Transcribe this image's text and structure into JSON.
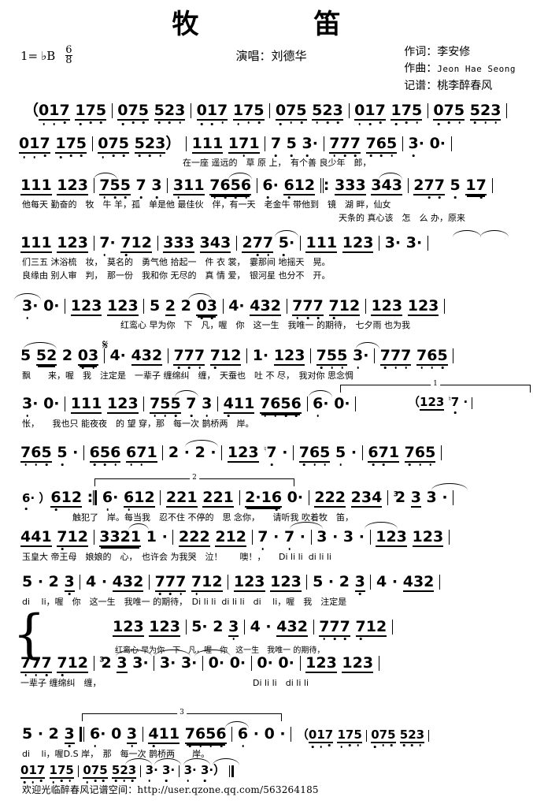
{
  "header": {
    "title": "牧　　笛",
    "key_label": "1=",
    "key_value": "♭B",
    "meter_num": "6",
    "meter_den": "8",
    "singer": "演唱：刘德华",
    "credits": [
      {
        "label": "作词：",
        "value": "李安修",
        "latin": false
      },
      {
        "label": "作曲：",
        "value": "Jeon Hae Seong",
        "latin": true
      },
      {
        "label": "记谱：",
        "value": "桃李醉春风",
        "latin": false
      }
    ]
  },
  "footer": {
    "text": "欢迎光临醉春风记谱空间：http://user.qzone.qq.com/563264185"
  },
  "chart_data": {
    "type": "table",
    "title": "牧笛 — 简谱 (Chinese numbered notation)",
    "key": "1=♭B",
    "time_signature": "6/8",
    "systems": [
      {
        "id": "intro-1",
        "notes": "（017 175 | 075 523 | 017 175 | 075 523 | 017 175 | 075 523 |",
        "lyrics": ""
      },
      {
        "id": "intro-2",
        "notes": "017 175 | 075 523）| 111 171 | 7 5 3· | 777 765 | 3· 0· |",
        "lyrics": "在一座 遥远的　草 原 上，　有个善 良少年　郎，"
      },
      {
        "id": "verse-1",
        "notes": "111 123 | 755 7 3 | 311 7656 | 6· 612 ‖: 333 343 | 277 5 17 |",
        "lyrics_1": "他每天 勤奋的　牧　牛 羊，孤　单是他 最佳伙　伴，有一天　老金牛 带他到　镜　湖 畔，仙女",
        "lyrics_2": "天条的 真心该　怎　么 办，原来"
      },
      {
        "id": "verse-2",
        "notes": "111 123 | 7· 712 | 333 343 | 277 5· | 111 123 | 3· 3· |",
        "lyrics_1": "们三五 沐浴梳　妆，　莫名的　勇气他 拾起一　件 衣 裳，　霎那间 地摇天　晃。",
        "lyrics_2": "良缘由 别人审　判，　那一份　我和你 无尽的　真 情 爱，　银河星 也分不　开。"
      },
      {
        "id": "chorus-1",
        "notes": "3· 0· | 123 123 | 5 2 2 03 | 4· 432 | 777 712 | 123 123 |",
        "lyrics": "　　　红鸾心 早为你　下　凡，喔　你　这一生　我唯一 的期待，　七夕雨 也为我"
      },
      {
        "id": "chorus-2",
        "notes": "5 52 2 03 | 4· 432 | 777 712 | 1· 123 | 755 3· | 777 765 |",
        "lyrics": "飘　　来，喔　我　注定是　一辈子 缠绵纠　缠，　天蚕也　吐 不 尽，　我对你 思念惆"
      },
      {
        "id": "chorus-3",
        "notes": "3· 0· | 111 123 | 755 7 3 | 411 7656 | 6· 0· | （123 ♮7· |",
        "lyrics": "怅，　　我也只 能夜夜　的 望 穿，那　每一次 鹊桥两　岸。",
        "volta": "1"
      },
      {
        "id": "inter-1",
        "notes": "765 5· | 656 671 | 2· 2· | 123 ♮7· | 765 5· | 671 765 |",
        "lyrics": ""
      },
      {
        "id": "inter-2",
        "notes": "6·）612 :‖ 6· 612 | 221 221 | 2·16 0· | 222 234 | ³2 3 3· |",
        "lyrics": "　　触犯了　岸。每当我　忍不住 不停的　思 念你，　　请听我 吹着牧　笛，",
        "volta": "2"
      },
      {
        "id": "bridge-1",
        "notes": "441 712 | 3321 1· | 222 212 | 7· 7· | 3· 3· | 123 123 |",
        "lyrics": "玉皇大 帝王母　娘娘的　心，　也许会 为我哭　泣！　　噢！，　　Di li li  di li li"
      },
      {
        "id": "bridge-2",
        "notes": "5· 2 3 | 4· 432 | 777 712 | 123 123 | 5· 2 3 | 4· 432 |",
        "lyrics": "di　 li，喔　你　这一生　我唯一 的期待，　Di li li  di li li　di　 li，喔　我　注定是"
      },
      {
        "id": "coda-upper",
        "notes": "123 123 | 5· 2 3 | 4· 432 | 777 712 |",
        "lyrics": "红鸾心 早为你　下　凡，喔　你　这一生　我唯一 的期待，"
      },
      {
        "id": "coda-lower",
        "notes": "777 712 | ³2 3 3· | 3· 3· | 0· 0· | 0· 0· | 123 123 |",
        "lyrics": "一辈子 缠绵纠　缠，　　　　　　　　　　　　　　　　　　Di li li　di li li"
      },
      {
        "id": "ending-1",
        "notes": "5· 2 3 ‖ 6· 0 3 | 411 7656 | 6· 0· | （017 175 | 075 523 |",
        "lyrics": "di　 li，喔D.S 岸，　那　每一次 鹊桥两　　岸。",
        "volta": "3"
      },
      {
        "id": "ending-2",
        "notes": "017 175 | 075 523 | 3· 3· | 3· 3·）‖",
        "lyrics": ""
      }
    ]
  },
  "music": {
    "row1": {
      "m": [
        {
          "pre": "（",
          "groups": [
            {
              "t": "017",
              "dots": [
                0,
                0,
                1
              ]
            },
            {
              "t": "175",
              "dots": [
                0,
                1,
                1
              ]
            }
          ]
        },
        {
          "groups": [
            {
              "t": "075",
              "dots": [
                0,
                1,
                1
              ]
            },
            {
              "t": "523",
              "dots": [
                1,
                1,
                1
              ]
            }
          ]
        },
        {
          "groups": [
            {
              "t": "017",
              "dots": [
                0,
                0,
                1
              ]
            },
            {
              "t": "175",
              "dots": [
                0,
                1,
                1
              ]
            }
          ]
        },
        {
          "groups": [
            {
              "t": "075",
              "dots": [
                0,
                1,
                1
              ]
            },
            {
              "t": "523",
              "dots": [
                1,
                1,
                1
              ]
            }
          ]
        },
        {
          "groups": [
            {
              "t": "017",
              "dots": [
                0,
                0,
                1
              ]
            },
            {
              "t": "175",
              "dots": [
                0,
                1,
                1
              ]
            }
          ]
        },
        {
          "groups": [
            {
              "t": "075",
              "dots": [
                0,
                1,
                1
              ]
            },
            {
              "t": "523",
              "dots": [
                1,
                1,
                1
              ]
            }
          ]
        }
      ]
    }
  },
  "labels": {
    "volta1": "1",
    "volta2": "2",
    "volta3": "3",
    "triplet": "3",
    "natural_seven": "♮7",
    "ds": "D.S",
    "repeat_open": "‖:",
    "repeat_close": ":‖"
  }
}
